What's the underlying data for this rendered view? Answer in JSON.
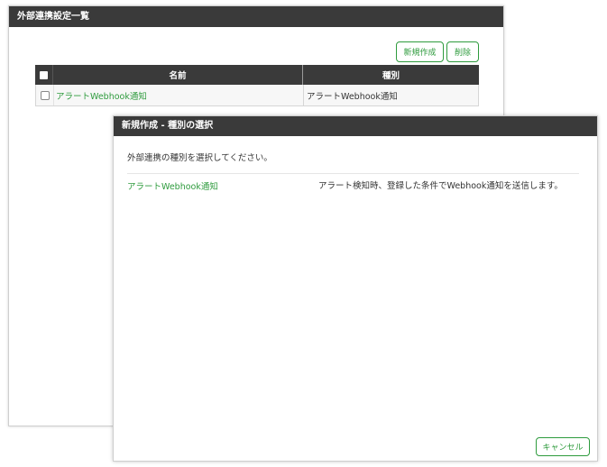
{
  "main_panel": {
    "title": "外部連携設定一覧",
    "new_button": "新規作成",
    "delete_button": "削除",
    "table": {
      "columns": [
        "",
        "名前",
        "種別"
      ],
      "rows": [
        {
          "name": "アラートWebhook通知",
          "type": "アラートWebhook通知"
        }
      ]
    }
  },
  "modal": {
    "title": "新規作成 - 種別の選択",
    "instruction": "外部連携の種別を選択してください。",
    "options": [
      {
        "name": "アラートWebhook通知",
        "description": "アラート検知時、登録した条件でWebhook通知を送信します。"
      }
    ],
    "cancel_button": "キャンセル"
  },
  "colors": {
    "header_bg": "#3a3a3a",
    "accent_green": "#2e9b3d",
    "row_bg": "#f7f7f7"
  }
}
